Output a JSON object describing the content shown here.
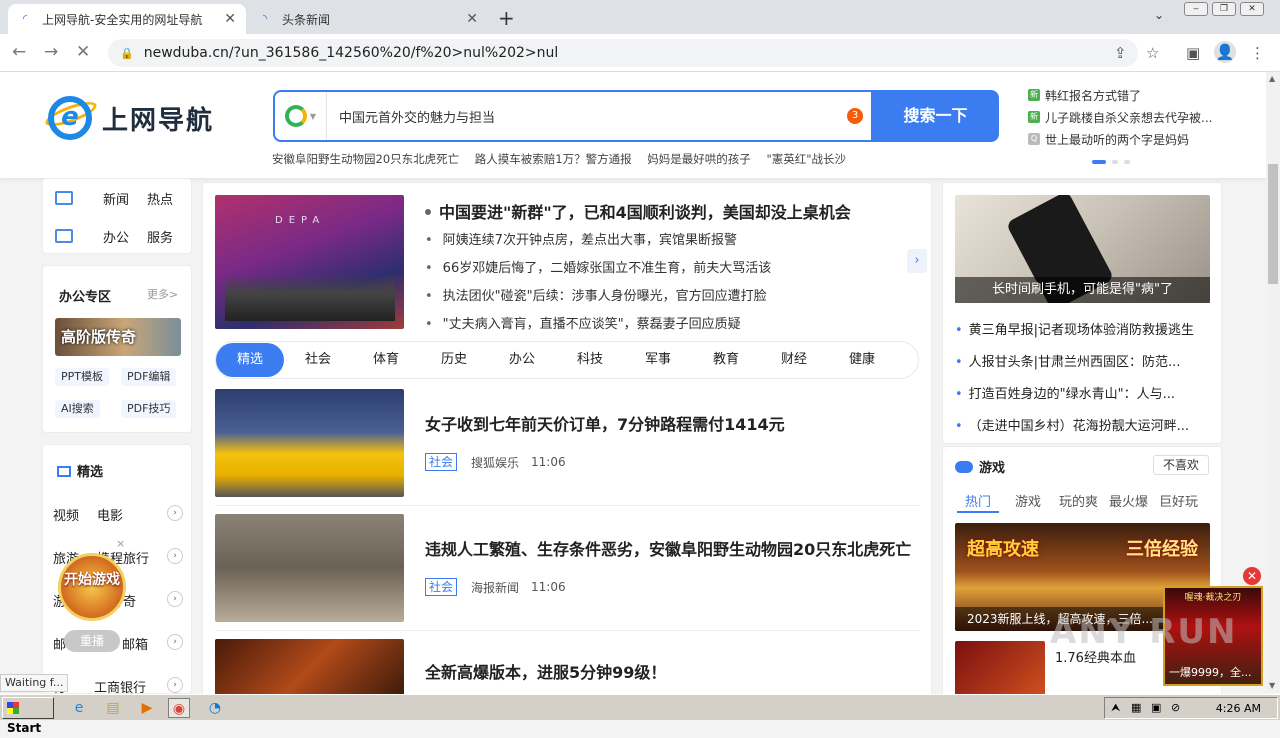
{
  "browser": {
    "tabs": [
      {
        "title": "上网导航-安全实用的网址导航",
        "active": true
      },
      {
        "title": "头条新闻",
        "active": false
      }
    ],
    "new_tab": "+",
    "url": "newduba.cn/?un_361586_142560%20/f%20>nul%202>nul"
  },
  "header": {
    "logo_text": "上网导航",
    "search": {
      "value": "中国元首外交的魅力与担当",
      "badge": "3",
      "button": "搜索一下"
    },
    "hot_links": [
      "安徽阜阳野生动物园20只东北虎死亡",
      "路人摸车被索赔1万？警方通报",
      "妈妈是最好哄的孩子",
      "\"憲英红\"战长沙"
    ],
    "right_news": [
      "韩红报名方式错了",
      "儿子跳楼自杀父亲想去代孕被...",
      "世上最动听的两个字是妈妈"
    ]
  },
  "left": {
    "quick": [
      [
        "新闻",
        "热点"
      ],
      [
        "办公",
        "服务"
      ]
    ],
    "office": {
      "title": "办公专区",
      "more": "更多>",
      "banner": "高阶版传奇",
      "tags": [
        "PPT模板",
        "PDF编辑",
        "AI搜索",
        "PDF技巧"
      ]
    },
    "featured": {
      "title": "精选",
      "rows": [
        [
          "视频",
          "电影"
        ],
        [
          "旅游",
          "携程旅行"
        ],
        [
          "游",
          "传奇"
        ],
        [
          "邮",
          "邮箱"
        ],
        [
          "行",
          "工商银行"
        ]
      ]
    },
    "game_badge": "开始游戏",
    "replay": "重播",
    "close": "×"
  },
  "main": {
    "top_image_text": "DEPA",
    "headline": "中国要进\"新群\"了，已和4国顺利谈判，美国却没上桌机会",
    "sub_news": [
      "阿姨连续7次开钟点房，差点出大事，宾馆果断报警",
      "66岁邓婕后悔了，二婚嫁张国立不准生育，前夫大骂活该",
      "执法团伙\"碰瓷\"后续：涉事人身份曝光，官方回应遭打脸",
      "\"丈夫病入膏肓，直播不应谈笑\"，蔡磊妻子回应质疑"
    ],
    "categories": [
      "精选",
      "社会",
      "体育",
      "历史",
      "办公",
      "科技",
      "军事",
      "教育",
      "财经",
      "健康"
    ],
    "feed": [
      {
        "title": "女子收到七年前天价订单，7分钟路程需付1414元",
        "cat": "社会",
        "source": "搜狐娱乐",
        "time": "11:06"
      },
      {
        "title": "违规人工繁殖、生存条件恶劣，安徽阜阳野生动物园20只东北虎死亡",
        "cat": "社会",
        "source": "海报新闻",
        "time": "11:06"
      },
      {
        "title": "全新高爆版本，进服5分钟99级！",
        "cat": "",
        "source": "",
        "time": ""
      }
    ]
  },
  "right": {
    "img_caption": "长时间刷手机，可能是得\"病\"了",
    "news": [
      "黄三角早报|记者现场体验消防救援逃生",
      "人报甘头条|甘肃兰州西固区：防范...",
      "打造百姓身边的\"绿水青山\"：人与...",
      "（走进中国乡村）花海扮靓大运河畔..."
    ],
    "games": {
      "title": "游戏",
      "dislike": "不喜欢",
      "tabs": [
        "热门",
        "游戏",
        "玩的爽",
        "最火爆",
        "巨好玩"
      ],
      "ad_left": "超高攻速",
      "ad_right": "三倍经验",
      "ad_caption": "2023新服上线，超高攻速，三倍...",
      "second": "1.76经典本血"
    },
    "corner_ad": {
      "head": "喔魂·裁决之刃",
      "foot": "一爆9999，全..."
    }
  },
  "status_text": "Waiting f...",
  "watermark": "ANY RUN",
  "taskbar": {
    "start": "Start",
    "clock": "4:26 AM"
  }
}
